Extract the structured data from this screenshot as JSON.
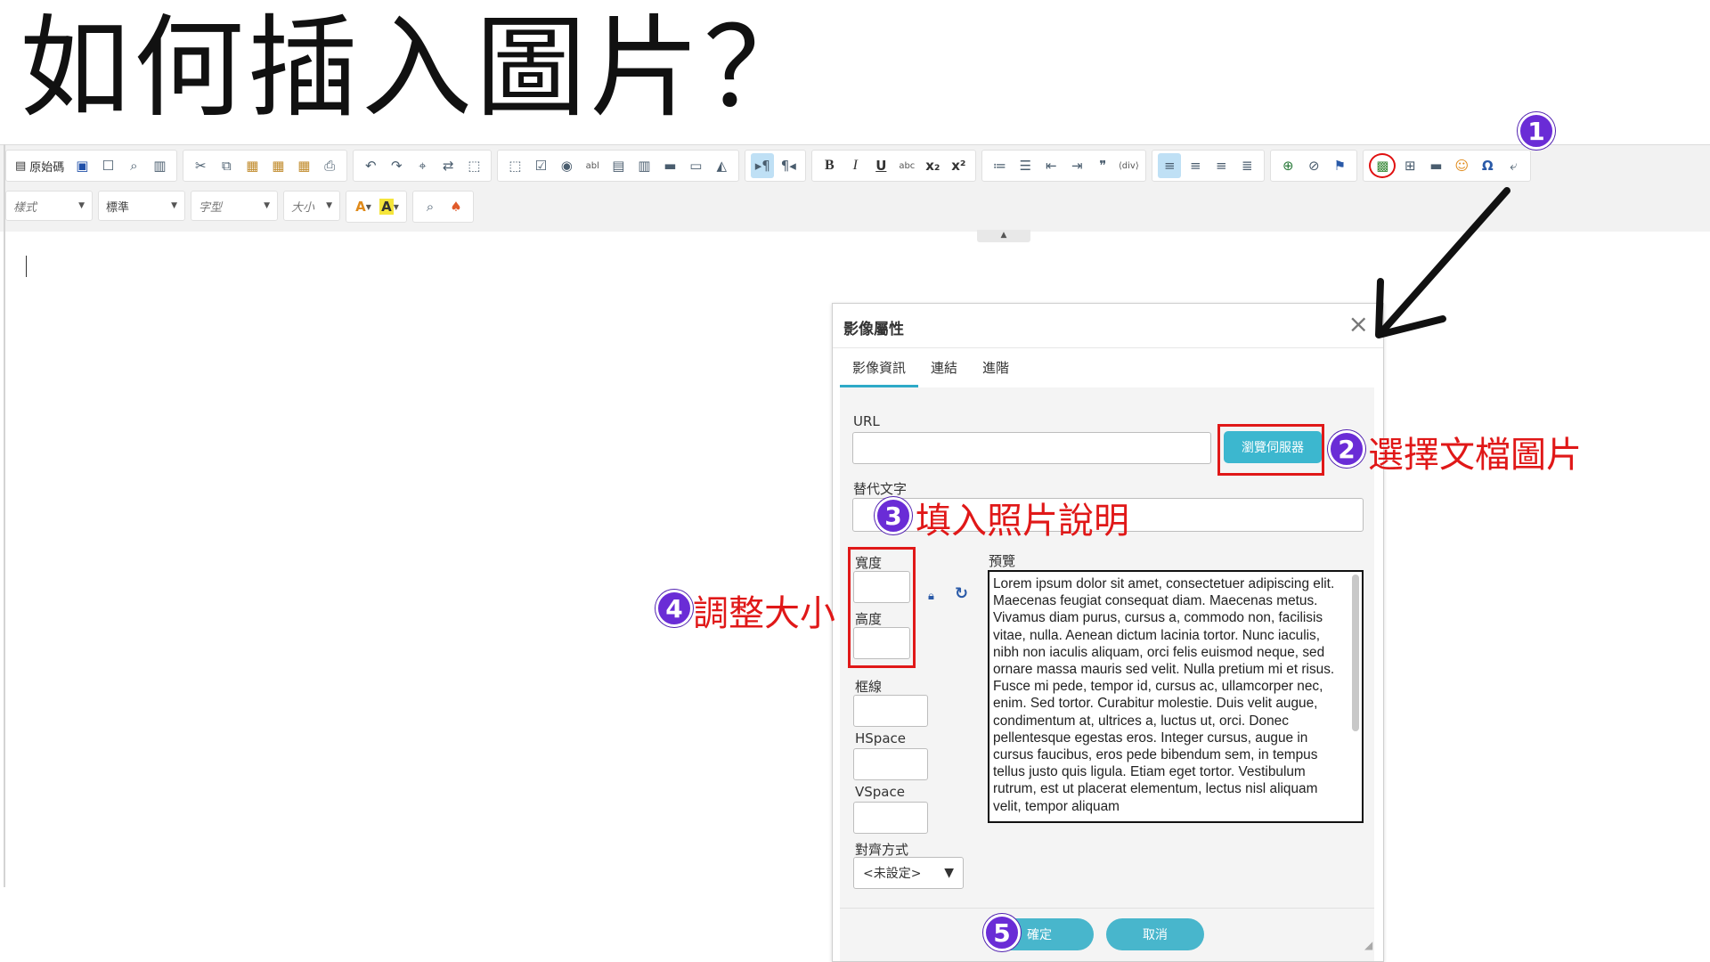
{
  "title": "如何插入圖片？",
  "toolbar": {
    "source_label": "原始碼",
    "format_style": "樣式",
    "format_normal": "標準",
    "font_name": "字型",
    "font_size": "大小",
    "bold": "B",
    "italic": "I",
    "underline": "U",
    "strike": "abc",
    "subscript": "x₂",
    "superscript": "x²",
    "quote": "❞",
    "omega": "Ω",
    "text_color": "A",
    "bg_color": "A"
  },
  "dialog": {
    "title": "影像屬性",
    "close": "×",
    "tabs": [
      "影像資訊",
      "連結",
      "進階"
    ],
    "url_label": "URL",
    "browse_button": "瀏覽伺服器",
    "alt_label": "替代文字",
    "width_label": "寬度",
    "height_label": "高度",
    "border_label": "框線",
    "hspace_label": "HSpace",
    "vspace_label": "VSpace",
    "align_label": "對齊方式",
    "align_value": "<未設定>",
    "preview_label": "預覽",
    "preview_text": "Lorem ipsum dolor sit amet, consectetuer adipiscing elit. Maecenas feugiat consequat diam. Maecenas metus. Vivamus diam purus, cursus a, commodo non, facilisis vitae, nulla. Aenean dictum lacinia tortor. Nunc iaculis, nibh non iaculis aliquam, orci felis euismod neque, sed ornare massa mauris sed velit. Nulla pretium mi et risus. Fusce mi pede, tempor id, cursus ac, ullamcorper nec, enim. Sed tortor. Curabitur molestie. Duis velit augue, condimentum at, ultrices a, luctus ut, orci. Donec pellentesque egestas eros. Integer cursus, augue in cursus faucibus, eros pede bibendum sem, in tempus tellus justo quis ligula. Etiam eget tortor. Vestibulum rutrum, est ut placerat elementum, lectus nisl aliquam velit, tempor aliquam",
    "ok_button": "確定",
    "cancel_button": "取消"
  },
  "annotations": {
    "step1_num": "1",
    "step2_num": "2",
    "step2_text": "選擇文檔圖片",
    "step3_num": "3",
    "step3_text": "填入照片說明",
    "step4_num": "4",
    "step4_text": "調整大小",
    "step5_num": "5",
    "accent_color": "#e01818",
    "badge_color": "#6a2cd6"
  }
}
